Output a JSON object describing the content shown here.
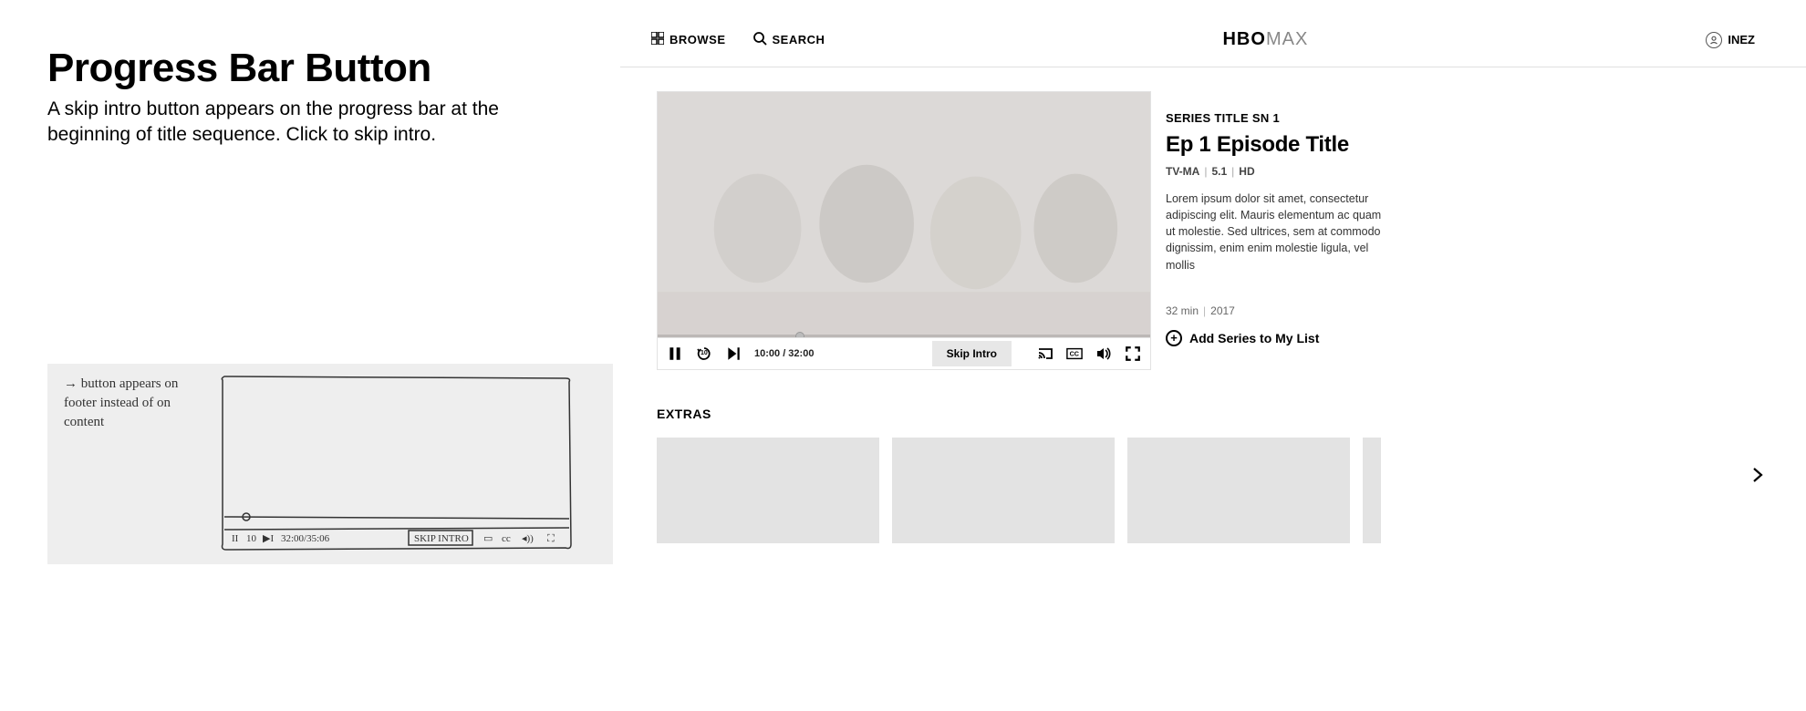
{
  "left": {
    "title": "Progress Bar Button",
    "subtitle": "A skip intro button appears on the progress bar at the beginning of title sequence. Click to skip intro.",
    "sketch_note": "→ button appears on footer instead of on content",
    "sketch_skip_label": "SKIP INTRO",
    "sketch_time": "32:00/35:06"
  },
  "nav": {
    "browse": "BROWSE",
    "search": "SEARCH",
    "logo_bold": "HBO",
    "logo_light": "MAX",
    "user": "INEZ"
  },
  "player": {
    "current_time": "10:00",
    "duration": "32:00",
    "time_display": "10:00 / 32:00",
    "rewind_seconds": "10",
    "skip_intro": "Skip Intro"
  },
  "meta": {
    "series_label": "SERIES TITLE SN 1",
    "episode_title": "Ep 1 Episode Title",
    "rating": "TV-MA",
    "audio": "5.1",
    "quality": "HD",
    "description": "Lorem ipsum dolor sit amet, consectetur adipiscing elit. Mauris elementum ac quam ut molestie. Sed ultrices, sem at commodo dignissim, enim enim molestie ligula, vel mollis",
    "runtime": "32 min",
    "year": "2017",
    "add_label": "Add Series to My List"
  },
  "extras": {
    "title": "EXTRAS"
  }
}
